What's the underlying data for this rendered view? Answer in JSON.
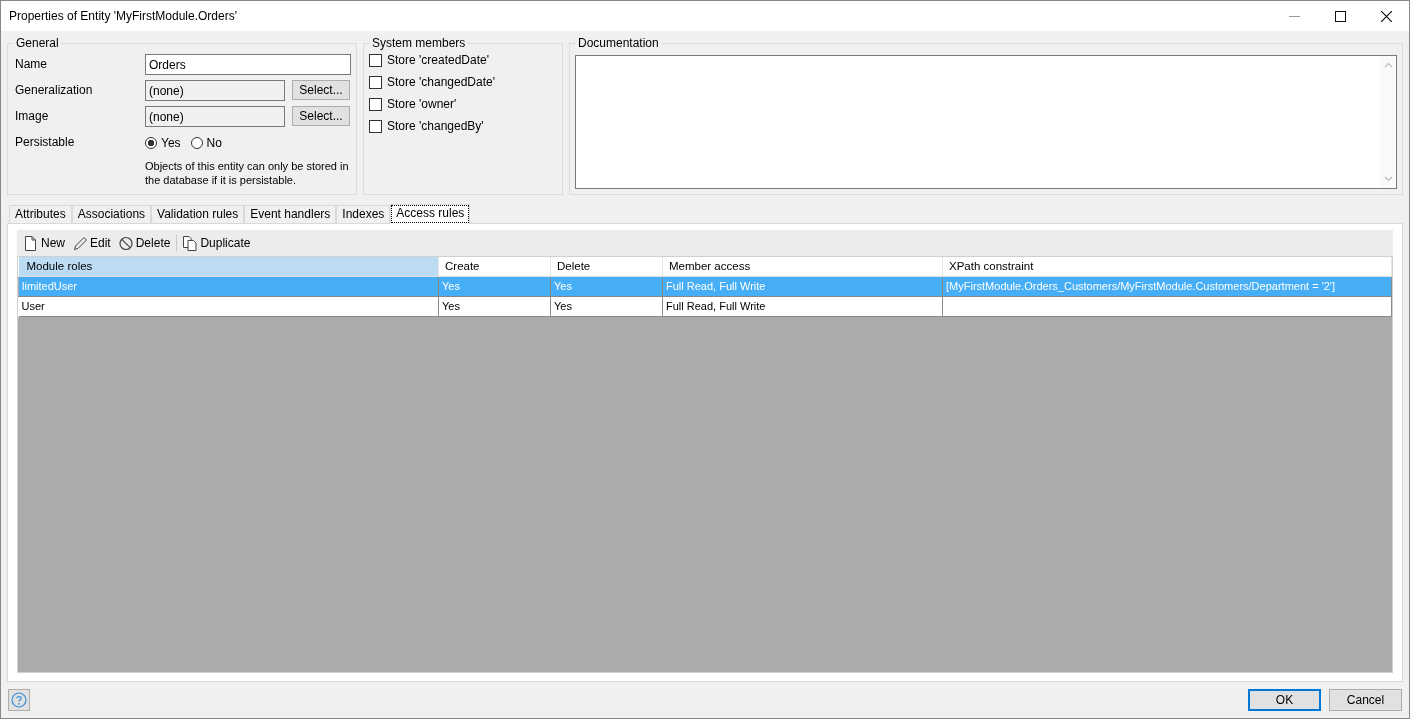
{
  "window": {
    "title": "Properties of Entity 'MyFirstModule.Orders'"
  },
  "general": {
    "legend": "General",
    "name": {
      "label": "Name",
      "value": "Orders"
    },
    "generalization": {
      "label": "Generalization",
      "value": "(none)",
      "button": "Select..."
    },
    "image": {
      "label": "Image",
      "value": "(none)",
      "button": "Select..."
    },
    "persistable": {
      "label": "Persistable",
      "options": [
        {
          "label": "Yes",
          "selected": true
        },
        {
          "label": "No",
          "selected": false
        }
      ],
      "note": "Objects of this entity can only be stored in the database if it is persistable."
    }
  },
  "system_members": {
    "legend": "System members",
    "items": [
      {
        "label": "Store 'createdDate'",
        "checked": false
      },
      {
        "label": "Store 'changedDate'",
        "checked": false
      },
      {
        "label": "Store 'owner'",
        "checked": false
      },
      {
        "label": "Store 'changedBy'",
        "checked": false
      }
    ]
  },
  "documentation": {
    "legend": "Documentation"
  },
  "tabs": [
    {
      "label": "Attributes",
      "selected": false
    },
    {
      "label": "Associations",
      "selected": false
    },
    {
      "label": "Validation rules",
      "selected": false
    },
    {
      "label": "Event handlers",
      "selected": false
    },
    {
      "label": "Indexes",
      "selected": false
    },
    {
      "label": "Access rules",
      "selected": true
    }
  ],
  "toolbar": [
    {
      "label": "New",
      "kind": "new"
    },
    {
      "label": "Edit",
      "kind": "edit"
    },
    {
      "label": "Delete",
      "kind": "delete"
    },
    {
      "label": "Duplicate",
      "kind": "duplicate"
    }
  ],
  "table": {
    "columns": [
      {
        "label": "Module roles",
        "sorted": true
      },
      {
        "label": "Create",
        "sorted": false
      },
      {
        "label": "Delete",
        "sorted": false
      },
      {
        "label": "Member access",
        "sorted": false
      },
      {
        "label": "XPath constraint",
        "sorted": false
      }
    ],
    "rows": [
      {
        "cells": [
          "limitedUser",
          "Yes",
          "Yes",
          "Full Read, Full Write",
          "[MyFirstModule.Orders_Customers/MyFirstModule.Customers/Department = '2']"
        ],
        "selected": true
      },
      {
        "cells": [
          "User",
          "Yes",
          "Yes",
          "Full Read, Full Write"
        ],
        "selected": false
      }
    ]
  },
  "buttons": [
    {
      "label": "OK",
      "default": true
    },
    {
      "label": "Cancel",
      "default": false
    }
  ]
}
